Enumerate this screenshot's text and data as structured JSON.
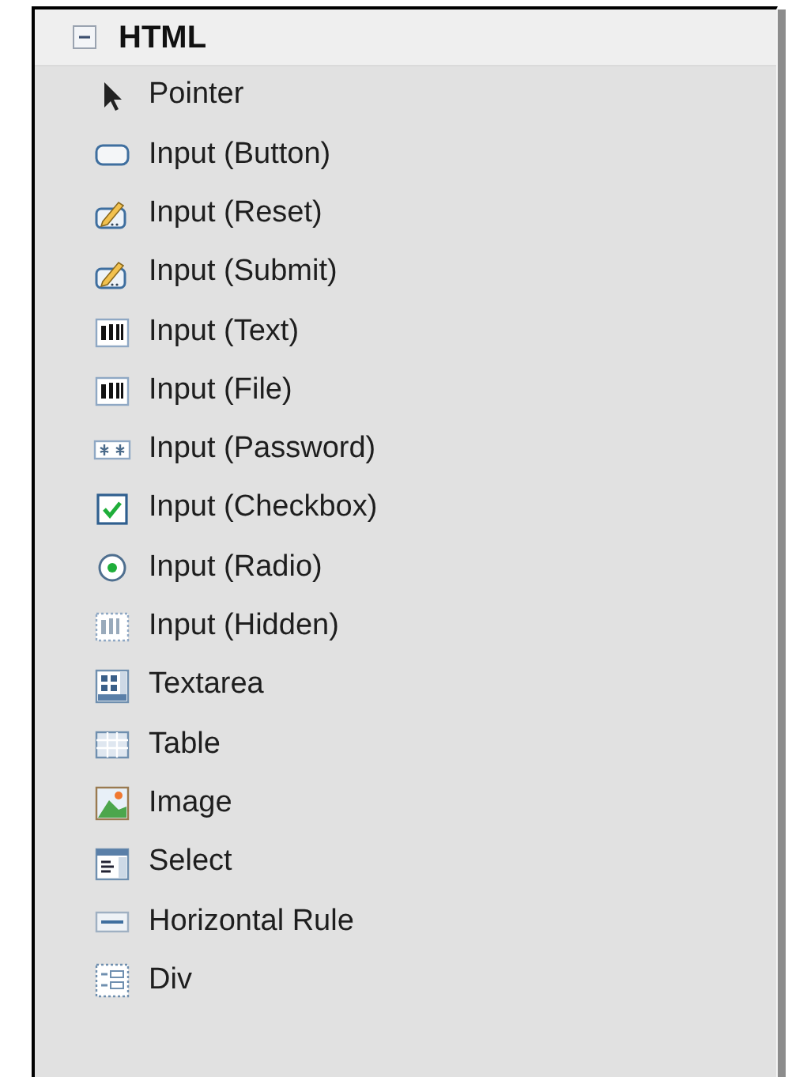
{
  "section": {
    "title": "HTML",
    "expanded": true
  },
  "items": [
    {
      "label": "Pointer",
      "kind": "pointer"
    },
    {
      "label": "Input (Button)",
      "kind": "button"
    },
    {
      "label": "Input (Reset)",
      "kind": "pencil"
    },
    {
      "label": "Input (Submit)",
      "kind": "pencil"
    },
    {
      "label": "Input (Text)",
      "kind": "text"
    },
    {
      "label": "Input (File)",
      "kind": "text"
    },
    {
      "label": "Input (Password)",
      "kind": "password"
    },
    {
      "label": "Input (Checkbox)",
      "kind": "checkbox"
    },
    {
      "label": "Input (Radio)",
      "kind": "radio"
    },
    {
      "label": "Input (Hidden)",
      "kind": "hidden"
    },
    {
      "label": "Textarea",
      "kind": "textarea"
    },
    {
      "label": "Table",
      "kind": "table"
    },
    {
      "label": "Image",
      "kind": "image"
    },
    {
      "label": "Select",
      "kind": "select"
    },
    {
      "label": "Horizontal Rule",
      "kind": "hr"
    },
    {
      "label": "Div",
      "kind": "div"
    }
  ]
}
